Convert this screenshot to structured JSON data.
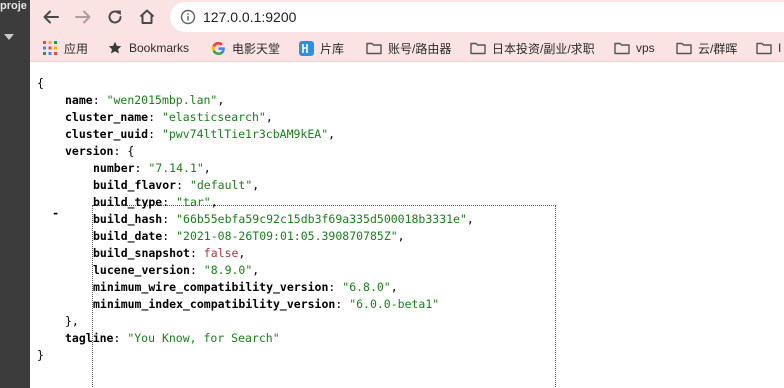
{
  "background_window": {
    "project_label": "proje"
  },
  "browser": {
    "url": "127.0.0.1:9200",
    "bookmarks": [
      {
        "label": "应用",
        "icon": "apps-grid-icon"
      },
      {
        "label": "Bookmarks",
        "icon": "star-icon"
      },
      {
        "label": "电影天堂",
        "icon": "google-icon"
      },
      {
        "label": "片库",
        "icon": "pianku-icon"
      },
      {
        "label": "账号/路由器",
        "icon": "folder-icon"
      },
      {
        "label": "日本投资/副业/求职",
        "icon": "folder-icon"
      },
      {
        "label": "vps",
        "icon": "folder-icon"
      },
      {
        "label": "云/群晖",
        "icon": "folder-icon"
      },
      {
        "label": "I",
        "icon": "folder-icon"
      }
    ],
    "colors": {
      "chrome_bg": "#fbe3e3",
      "string": "#1a7f1a",
      "boolean": "#b0363b"
    }
  },
  "json": {
    "open": "{",
    "close": "}",
    "name_key": "name",
    "name_val": "\"wen2015mbp.lan\"",
    "cluster_name_key": "cluster_name",
    "cluster_name_val": "\"elasticsearch\"",
    "cluster_uuid_key": "cluster_uuid",
    "cluster_uuid_val": "\"pwv74ltlTie1r3cbAM9kEA\"",
    "collapse_toggle": "-",
    "version_key": "version",
    "version_open": "{",
    "version": {
      "number_key": "number",
      "number_val": "\"7.14.1\"",
      "build_flavor_key": "build_flavor",
      "build_flavor_val": "\"default\"",
      "build_type_key": "build_type",
      "build_type_val": "\"tar\"",
      "build_hash_key": "build_hash",
      "build_hash_val": "\"66b55ebfa59c92c15db3f69a335d500018b3331e\"",
      "build_date_key": "build_date",
      "build_date_val": "\"2021-08-26T09:01:05.390870785Z\"",
      "build_snapshot_key": "build_snapshot",
      "build_snapshot_val": "false",
      "lucene_version_key": "lucene_version",
      "lucene_version_val": "\"8.9.0\"",
      "min_wire_key": "minimum_wire_compatibility_version",
      "min_wire_val": "\"6.8.0\"",
      "min_index_key": "minimum_index_compatibility_version",
      "min_index_val": "\"6.0.0-beta1\""
    },
    "version_close": "},",
    "tagline_key": "tagline",
    "tagline_val": "\"You Know, for Search\""
  }
}
